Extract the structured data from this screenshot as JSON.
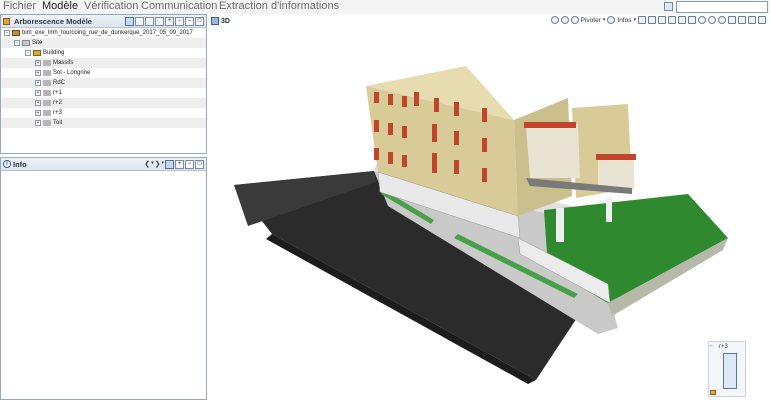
{
  "menubar": {
    "items": [
      "Fichier",
      "Modèle",
      "Vérification",
      "Communication",
      "Extraction d'informations"
    ],
    "active_index": 1
  },
  "tree_panel": {
    "title": "Arborescence Modèle",
    "project": "bim_exe_lmh_tourcoing_rue_de_dunkerque_2017_05_09_2017",
    "site": "Site",
    "building": "Building",
    "floors": [
      "Massifs",
      "Sol - Longrine",
      "RdC",
      "r+1",
      "r+2",
      "r+3",
      "Toit"
    ]
  },
  "info_panel": {
    "title": "Info"
  },
  "view3d": {
    "label": "3D",
    "pivot_label": "Pivoter",
    "infos_label": "Infos",
    "navcube_level": "r+3"
  },
  "colors": {
    "facade": "#d8cb98",
    "window_frame": "#c0452a",
    "glass": "#6a6f7d",
    "ground_dark": "#2b2b2b",
    "lawn": "#2f8a2f",
    "podium": "#c2c2c2"
  },
  "icons": [
    "tree-view-icon",
    "expand-icon",
    "folder-icon",
    "building-icon",
    "site-icon",
    "info-icon",
    "cube-icon",
    "pivot-icon",
    "zoom-in-icon",
    "zoom-out-icon",
    "zoom-fit-icon",
    "home-icon"
  ]
}
